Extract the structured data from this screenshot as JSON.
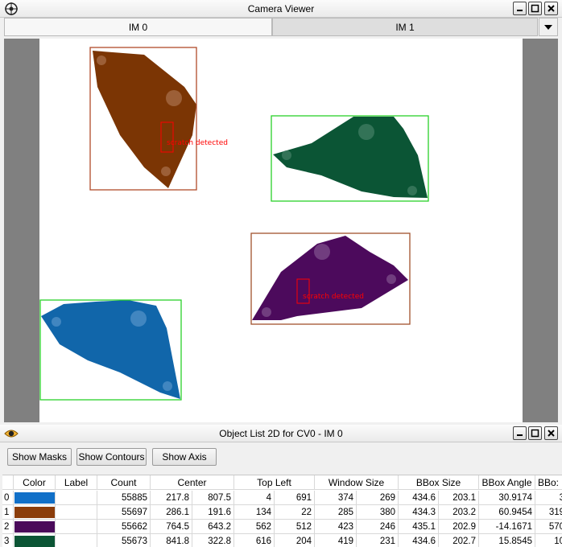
{
  "camera_viewer": {
    "title": "Camera Viewer",
    "tabs": [
      {
        "label": "IM 0",
        "active": true
      },
      {
        "label": "IM 1",
        "active": false
      }
    ],
    "tab_menu_icon": "dropdown-arrow-icon",
    "window_buttons": [
      "minimize-icon",
      "maximize-icon",
      "close-icon"
    ],
    "annotations": [
      {
        "label": "scratch detected",
        "color": "#ff0000"
      },
      {
        "label": "scratch detected",
        "color": "#ff0000"
      }
    ],
    "object_colors": {
      "blue": "#1166aa",
      "brown": "#7b3504",
      "purple": "#4c0a5c",
      "green": "#0b5535",
      "bbox_green": "#00cc00",
      "bbox_brown": "#a0522d"
    }
  },
  "object_list": {
    "title": "Object List 2D for CV0 - IM 0",
    "buttons": [
      "Show Masks",
      "Show Contours",
      "Show Axis"
    ],
    "columns": [
      "Color",
      "Label",
      "Count",
      "Center",
      "Top Left",
      "Window Size",
      "BBox Size",
      "BBox Angle",
      "BBo:"
    ],
    "rows": [
      {
        "index": "0",
        "color": "#1170c8",
        "label": "",
        "count": "55885",
        "center": [
          "217.8",
          "807.5"
        ],
        "top_left": [
          "4",
          "691"
        ],
        "window_size": [
          "374",
          "269"
        ],
        "bbox_size": [
          "434.6",
          "203.1"
        ],
        "bbox_angle": "30.9174",
        "bbox_extra": "3"
      },
      {
        "index": "1",
        "color": "#8b3d0b",
        "label": "",
        "count": "55697",
        "center": [
          "286.1",
          "191.6"
        ],
        "top_left": [
          "134",
          "22"
        ],
        "window_size": [
          "285",
          "380"
        ],
        "bbox_size": [
          "434.3",
          "203.2"
        ],
        "bbox_angle": "60.9454",
        "bbox_extra": "319"
      },
      {
        "index": "2",
        "color": "#4a0a5a",
        "label": "",
        "count": "55662",
        "center": [
          "764.5",
          "643.2"
        ],
        "top_left": [
          "562",
          "512"
        ],
        "window_size": [
          "423",
          "246"
        ],
        "bbox_size": [
          "435.1",
          "202.9"
        ],
        "bbox_angle": "-14.1671",
        "bbox_extra": "570"
      },
      {
        "index": "3",
        "color": "#0b5535",
        "label": "",
        "count": "55673",
        "center": [
          "841.8",
          "322.8"
        ],
        "top_left": [
          "616",
          "204"
        ],
        "window_size": [
          "419",
          "231"
        ],
        "bbox_size": [
          "434.6",
          "202.7"
        ],
        "bbox_angle": "15.8545",
        "bbox_extra": "10"
      }
    ]
  }
}
